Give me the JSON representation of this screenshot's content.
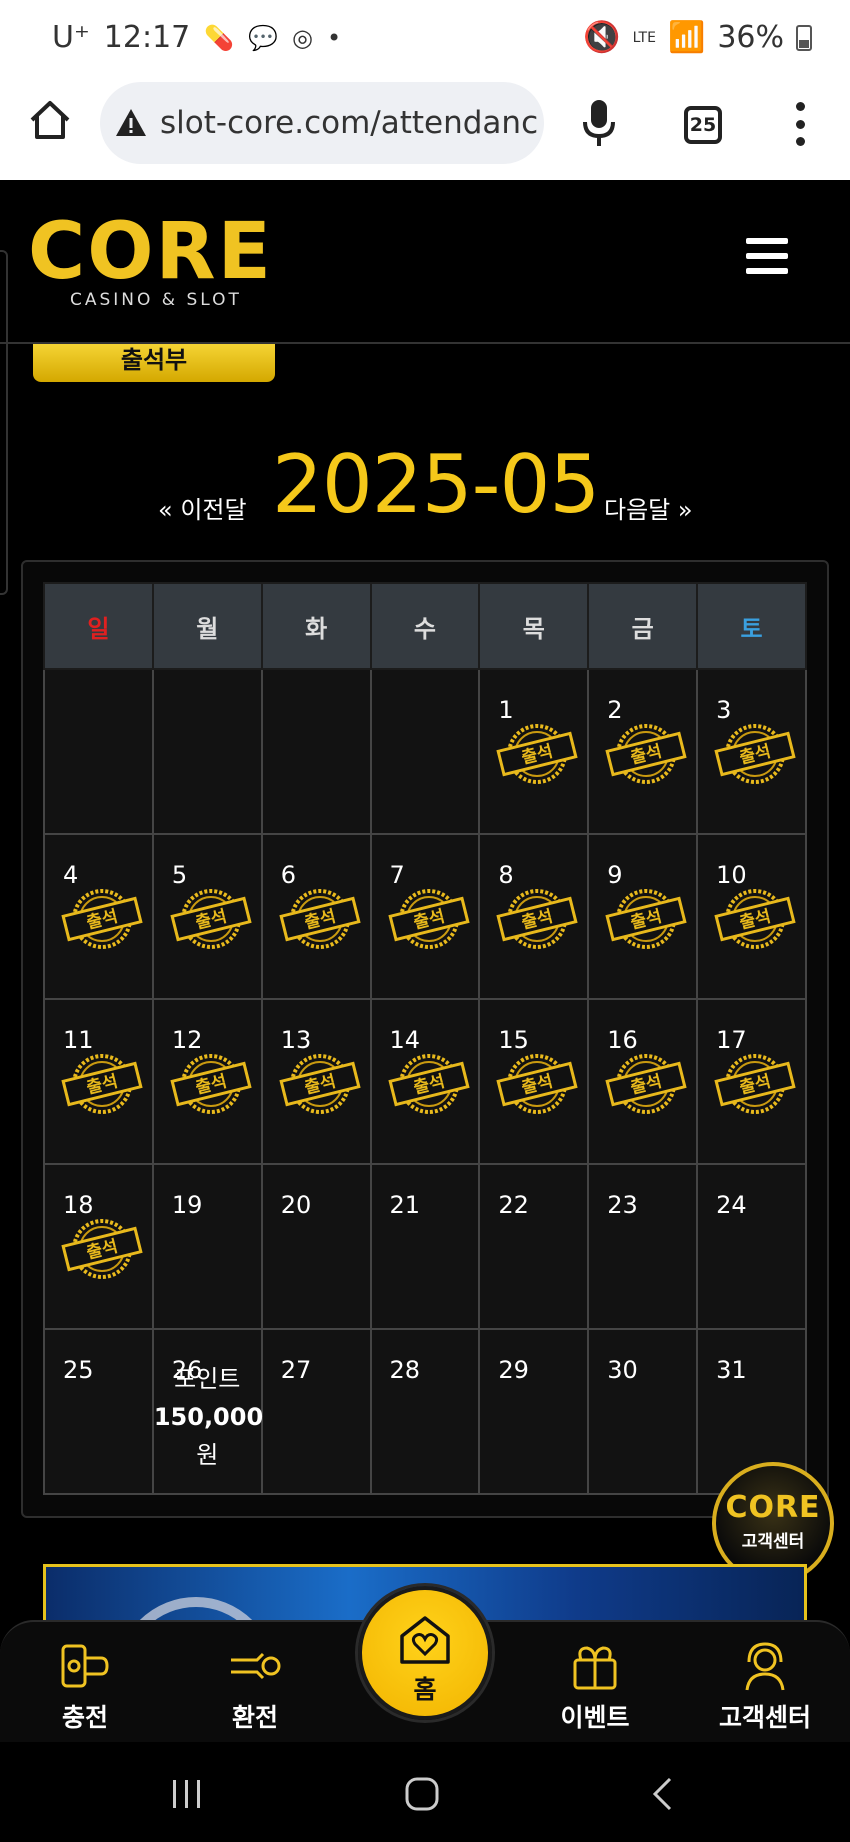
{
  "status_bar": {
    "carrier": "U⁺",
    "time": "12:17",
    "battery": "36%",
    "network": "LTE"
  },
  "browser": {
    "url": "slot-core.com/attendanc",
    "tab_count": "25"
  },
  "header": {
    "logo_text": "CORE",
    "logo_sub": "CASINO & SLOT"
  },
  "page": {
    "tab_label": "출석부",
    "prev_month": "« 이전달",
    "current_month": "2025-05",
    "next_month": "다음달 »"
  },
  "calendar": {
    "weekdays": [
      "일",
      "월",
      "화",
      "수",
      "목",
      "금",
      "토"
    ],
    "weeks": [
      [
        null,
        null,
        null,
        null,
        "1",
        "2",
        "3"
      ],
      [
        "4",
        "5",
        "6",
        "7",
        "8",
        "9",
        "10"
      ],
      [
        "11",
        "12",
        "13",
        "14",
        "15",
        "16",
        "17"
      ],
      [
        "18",
        "19",
        "20",
        "21",
        "22",
        "23",
        "24"
      ],
      [
        "25",
        "26",
        "27",
        "28",
        "29",
        "30",
        "31"
      ]
    ],
    "stamped_days": [
      "1",
      "2",
      "3",
      "4",
      "5",
      "6",
      "7",
      "8",
      "9",
      "10",
      "11",
      "12",
      "13",
      "14",
      "15",
      "16",
      "17",
      "18"
    ],
    "stamp_label": "출석",
    "bonus": {
      "day": "26",
      "line1": "포인트",
      "line2": "150,000",
      "line3": "원"
    }
  },
  "floating_cs": {
    "logo": "CORE",
    "label": "고객센터"
  },
  "bottom_nav": {
    "charge": "충전",
    "exchange": "환전",
    "home": "홈",
    "event": "이벤트",
    "support": "고객센터"
  },
  "colors": {
    "accent": "#f5c81a",
    "sunday": "#e02020",
    "saturday": "#3aa0e0",
    "logo_o": "#1fa7c8"
  }
}
